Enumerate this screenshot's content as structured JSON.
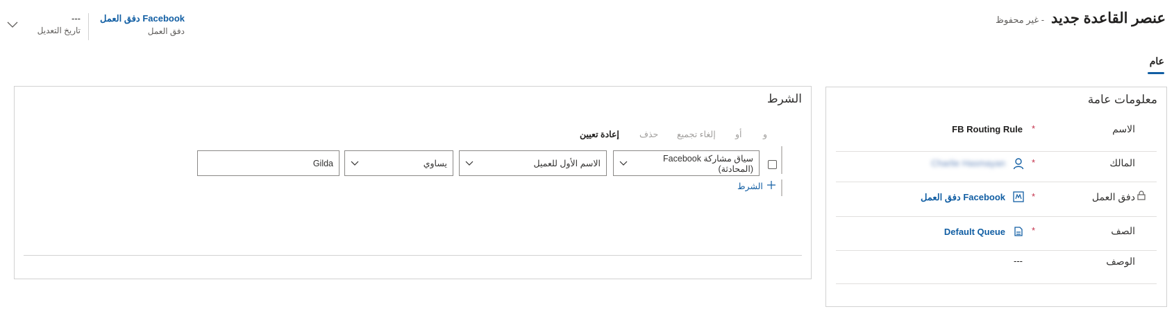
{
  "header": {
    "title": "عنصر القاعدة جديد",
    "save_status": "- غير محفوظ",
    "workflow_link": "دفق العمل Facebook",
    "workflow_label": "دفق العمل",
    "modified_value": "---",
    "modified_label": "تاريخ التعديل"
  },
  "tabs": [
    {
      "label": "عام",
      "selected": true
    }
  ],
  "general_info": {
    "title": "معلومات عامة",
    "name_label": "الاسم",
    "name_value": "FB Routing Rule",
    "owner_label": "المالك",
    "owner_value": "Charlie Hasmayan",
    "workflow_label": "دفق العمل",
    "workflow_value": "دفق العمل Facebook",
    "queue_label": "الصف",
    "queue_value": "Default Queue",
    "description_label": "الوصف",
    "description_value": "---",
    "required_mark": "*"
  },
  "condition": {
    "title": "الشرط",
    "commands": {
      "and": "و",
      "or": "أو",
      "ungroup": "إلغاء تجميع",
      "delete": "حذف",
      "reset": "إعادة تعيين"
    },
    "row": {
      "entity": "سياق مشاركة Facebook (المحادثة)",
      "attribute": "الاسم الأول للعميل",
      "operator": "يساوي",
      "value": "Gilda"
    },
    "add_label": "الشرط"
  },
  "colors": {
    "accent": "#115ea3",
    "required": "#c4314b",
    "border": "#d1d1d1"
  }
}
